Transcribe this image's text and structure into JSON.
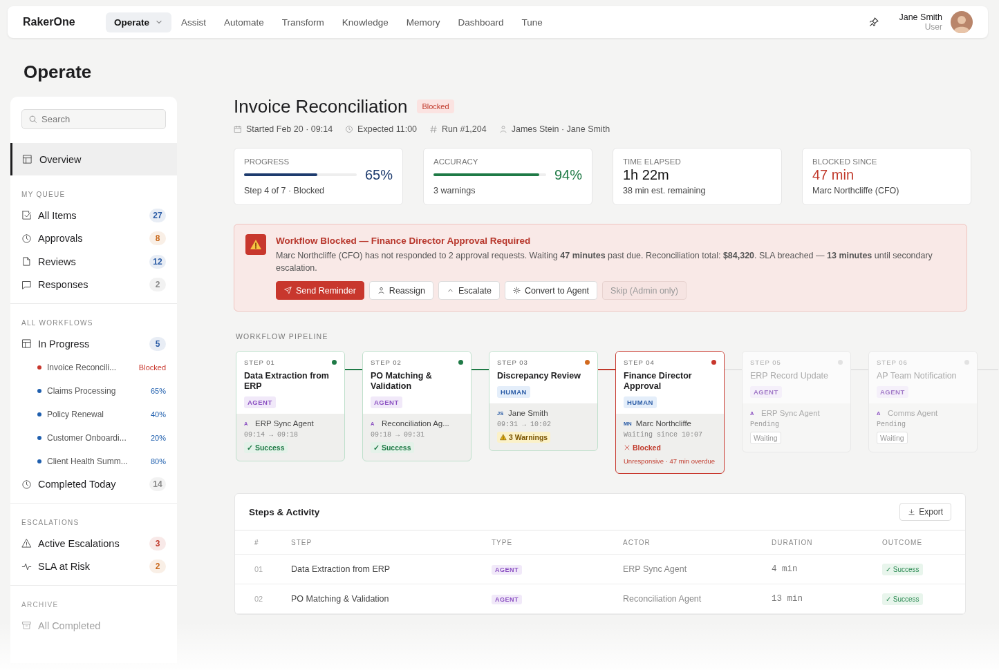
{
  "nav": {
    "brand": "RakerOne",
    "items": [
      {
        "label": "Operate",
        "selected": true,
        "dropdown": true
      },
      {
        "label": "Assist",
        "selected": false,
        "dropdown": false
      },
      {
        "label": "Automate",
        "selected": false,
        "dropdown": false
      },
      {
        "label": "Transform",
        "selected": false,
        "dropdown": false
      },
      {
        "label": "Knowledge",
        "selected": false,
        "dropdown": false
      },
      {
        "label": "Memory",
        "selected": false,
        "dropdown": false
      },
      {
        "label": "Dashboard",
        "selected": false,
        "dropdown": false
      },
      {
        "label": "Tune",
        "selected": false,
        "dropdown": false
      }
    ],
    "user": {
      "name": "Jane Smith",
      "role": "User"
    }
  },
  "page_title": "Operate",
  "sidebar": {
    "search": {
      "placeholder": "Search"
    },
    "overview": {
      "label": "Overview",
      "selected": true
    },
    "sections": [
      {
        "heading": "MY QUEUE",
        "items": [
          {
            "label": "All Items",
            "count": "27",
            "color": "#2b5ca6"
          },
          {
            "label": "Approvals",
            "count": "8",
            "color": "#c9691c"
          },
          {
            "label": "Reviews",
            "count": "12",
            "color": "#2b5ca6"
          },
          {
            "label": "Responses",
            "count": "2",
            "color": "#888888"
          }
        ]
      },
      {
        "heading": "ALL WORKFLOWS",
        "items": [
          {
            "label": "In Progress",
            "count": "5",
            "color": "#2b5ca6",
            "children": [
              {
                "label": "Invoice Reconcili...",
                "status": "Blocked",
                "color": "#c8372d"
              },
              {
                "label": "Claims Processing",
                "status": "65%",
                "color": "#1f5fae"
              },
              {
                "label": "Policy Renewal",
                "status": "40%",
                "color": "#1f5fae"
              },
              {
                "label": "Customer Onboardi...",
                "status": "20%",
                "color": "#1f5fae"
              },
              {
                "label": "Client Health Summ...",
                "status": "80%",
                "color": "#1f5fae"
              }
            ]
          },
          {
            "label": "Completed Today",
            "count": "14",
            "color": "#888888"
          }
        ]
      },
      {
        "heading": "ESCALATIONS",
        "items": [
          {
            "label": "Active Escalations",
            "count": "3",
            "color": "#c0392b"
          },
          {
            "label": "SLA at Risk",
            "count": "2",
            "color": "#c9691c"
          }
        ]
      },
      {
        "heading": "ARCHIVE",
        "items": [
          {
            "label": "All Completed"
          }
        ]
      }
    ]
  },
  "header": {
    "title": "Invoice Reconciliation",
    "status": "Blocked",
    "meta": [
      "Started Feb 20 · 09:14",
      "Expected 11:00",
      "Run #1,204",
      "James Stein · Jane Smith"
    ]
  },
  "stats": [
    {
      "kind": "meter",
      "label": "PROGRESS",
      "value": "65%",
      "sub": "Step 4 of 7 · Blocked",
      "level": 0.65,
      "color": "#1d3b6e"
    },
    {
      "kind": "meter",
      "label": "ACCURACY",
      "value": "94%",
      "sub": "3 warnings",
      "level": 0.94,
      "color": "#1f7a46"
    },
    {
      "kind": "plain",
      "label": "TIME ELAPSED",
      "value": "1h 22m",
      "sub": "38 min est. remaining",
      "color": "#111111"
    },
    {
      "kind": "plain",
      "label": "BLOCKED SINCE",
      "value": "47 min",
      "sub": "Marc Northcliffe (CFO)",
      "color": "#c0392b"
    }
  ],
  "alert": {
    "title": "Workflow Blocked — Finance Director Approval Required",
    "message": "Marc Northcliffe (CFO) has not responded to 2 approval requests. Waiting **47 minutes** past due. Reconciliation total: **$84,320**. SLA breached — **13 minutes** until secondary escalation.",
    "actions": [
      {
        "label": "Send Reminder",
        "kind": "primary"
      },
      {
        "label": "Reassign",
        "kind": "default"
      },
      {
        "label": "Escalate",
        "kind": "default"
      },
      {
        "label": "Convert to Agent",
        "kind": "default"
      },
      {
        "label": "Skip (Admin only)",
        "kind": "disabled"
      }
    ]
  },
  "pipeline": {
    "heading": "WORKFLOW PIPELINE",
    "steps": [
      {
        "step": "STEP 01",
        "title": "Data Extraction from ERP",
        "type": "AGENT",
        "kind": "done",
        "initials": "A",
        "actor": "ERP Sync Agent",
        "time": "09:14 → 09:18",
        "outcome": "✓ Success"
      },
      {
        "step": "STEP 02",
        "title": "PO Matching & Validation",
        "type": "AGENT",
        "kind": "done",
        "initials": "A",
        "actor": "Reconciliation Ag...",
        "time": "09:18 → 09:31",
        "outcome": "✓ Success"
      },
      {
        "step": "STEP 03",
        "title": "Discrepancy Review",
        "type": "HUMAN",
        "kind": "warning",
        "initials": "JS",
        "actor": "Jane Smith",
        "time": "09:31 → 10:02",
        "outcome": "3 Warnings"
      },
      {
        "step": "STEP 04",
        "title": "Finance Director Approval",
        "type": "HUMAN",
        "kind": "blocked",
        "initials": "MN",
        "actor": "Marc Northcliffe",
        "time": "Waiting since 10:07",
        "outcome": "Blocked",
        "note": "Unresponsive · 47 min overdue"
      },
      {
        "step": "STEP 05",
        "title": "ERP Record Update",
        "type": "AGENT",
        "kind": "pending",
        "initials": "A",
        "actor": "ERP Sync Agent",
        "time": "Pending",
        "outcome": "Waiting"
      },
      {
        "step": "STEP 06",
        "title": "AP Team Notification",
        "type": "AGENT",
        "kind": "pending",
        "initials": "A",
        "actor": "Comms Agent",
        "time": "Pending",
        "outcome": "Waiting"
      }
    ]
  },
  "activity": {
    "title": "Steps & Activity",
    "export": "Export",
    "columns": [
      "#",
      "STEP",
      "TYPE",
      "ACTOR",
      "DURATION",
      "OUTCOME"
    ],
    "rows": [
      {
        "num": "01",
        "step": "Data Extraction from ERP",
        "type": "AGENT",
        "actor": "ERP Sync Agent",
        "duration": "4 min",
        "outcome": "✓ Success"
      },
      {
        "num": "02",
        "step": "PO Matching & Validation",
        "type": "AGENT",
        "actor": "Reconciliation Agent",
        "duration": "13 min",
        "outcome": "✓ Success"
      }
    ]
  }
}
